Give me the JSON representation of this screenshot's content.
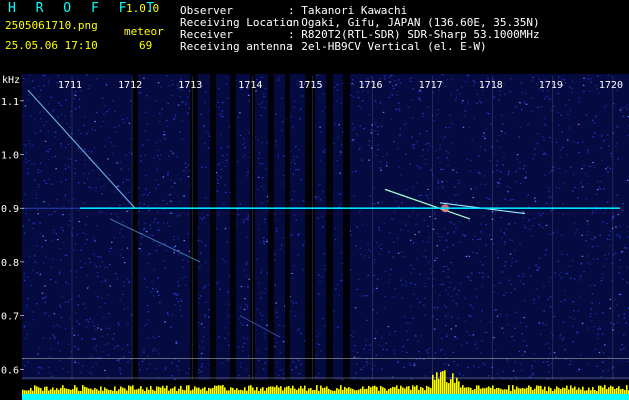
{
  "header": {
    "app_name": "H R O F F T",
    "version": "1.0.0",
    "filename": "2505061710.png",
    "timestamp": "25.05.06 17:10",
    "meteor_label": "meteor",
    "meteor_count": "69",
    "info": [
      {
        "label": "Observer",
        "value": ": Takanori Kawachi"
      },
      {
        "label": "Receiving Location",
        "value": ": Ogaki, Gifu, JAPAN (136.60E, 35.35N)"
      },
      {
        "label": "Receiver",
        "value": ": R820T2(RTL-SDR) SDR-Sharp 53.1000MHz"
      },
      {
        "label": "Receiving antenna",
        "value": ": 2el-HB9CV Vertical (el. E-W)"
      }
    ]
  },
  "chart_data": {
    "type": "heatmap",
    "ylabel": "kHz",
    "y_ticks": [
      "1.1",
      "1.0",
      "0.9",
      "0.8",
      "0.7",
      "0.6"
    ],
    "x_ticks": [
      "1711",
      "1712",
      "1713",
      "1714",
      "1715",
      "1716",
      "1717",
      "1718",
      "1719",
      "1720"
    ],
    "carrier_khz": 0.9,
    "colors": {
      "background": "#000000",
      "noise": "#1a2a9a",
      "carrier": "#00e0ff",
      "axis_text": "#ffffff",
      "amplitude_bars": "#ffff00",
      "amplitude_base": "#00ffff"
    }
  }
}
